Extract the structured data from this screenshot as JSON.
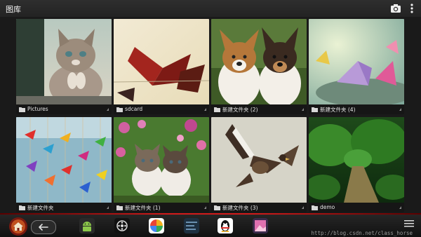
{
  "action_bar": {
    "title": "图库",
    "camera_icon": "camera-icon",
    "overflow_icon": "overflow-menu-icon"
  },
  "albums": [
    {
      "label": "Pictures",
      "thumb": "kitten"
    },
    {
      "label": "sdcard",
      "thumb": "paper-cranes-red"
    },
    {
      "label": "新建文件夹 (2)",
      "thumb": "two-puppies"
    },
    {
      "label": "新建文件夹 (4)",
      "thumb": "paper-cranes-pastel"
    },
    {
      "label": "新建文件夹",
      "thumb": "paper-crane-strings"
    },
    {
      "label": "新建文件夹 (1)",
      "thumb": "kittens-in-flowers"
    },
    {
      "label": "新建文件夹 (3)",
      "thumb": "hawk"
    },
    {
      "label": "demo",
      "thumb": "forest-path"
    }
  ],
  "nav_bar": {
    "home_icon": "home-icon",
    "back_icon": "back-arrow-icon",
    "dock": [
      "android-app-icon",
      "film-app-icon",
      "colorful-app-icon",
      "dark-app-icon",
      "qq-penguin-icon",
      "gallery-app-icon"
    ],
    "watermark": "http://blog.csdn.net/class_horse",
    "menu_icon": "menu-icon"
  },
  "colors": {
    "background": "#1a1a1a",
    "accent_red": "#d21b1b",
    "label_bar": "#141414"
  }
}
